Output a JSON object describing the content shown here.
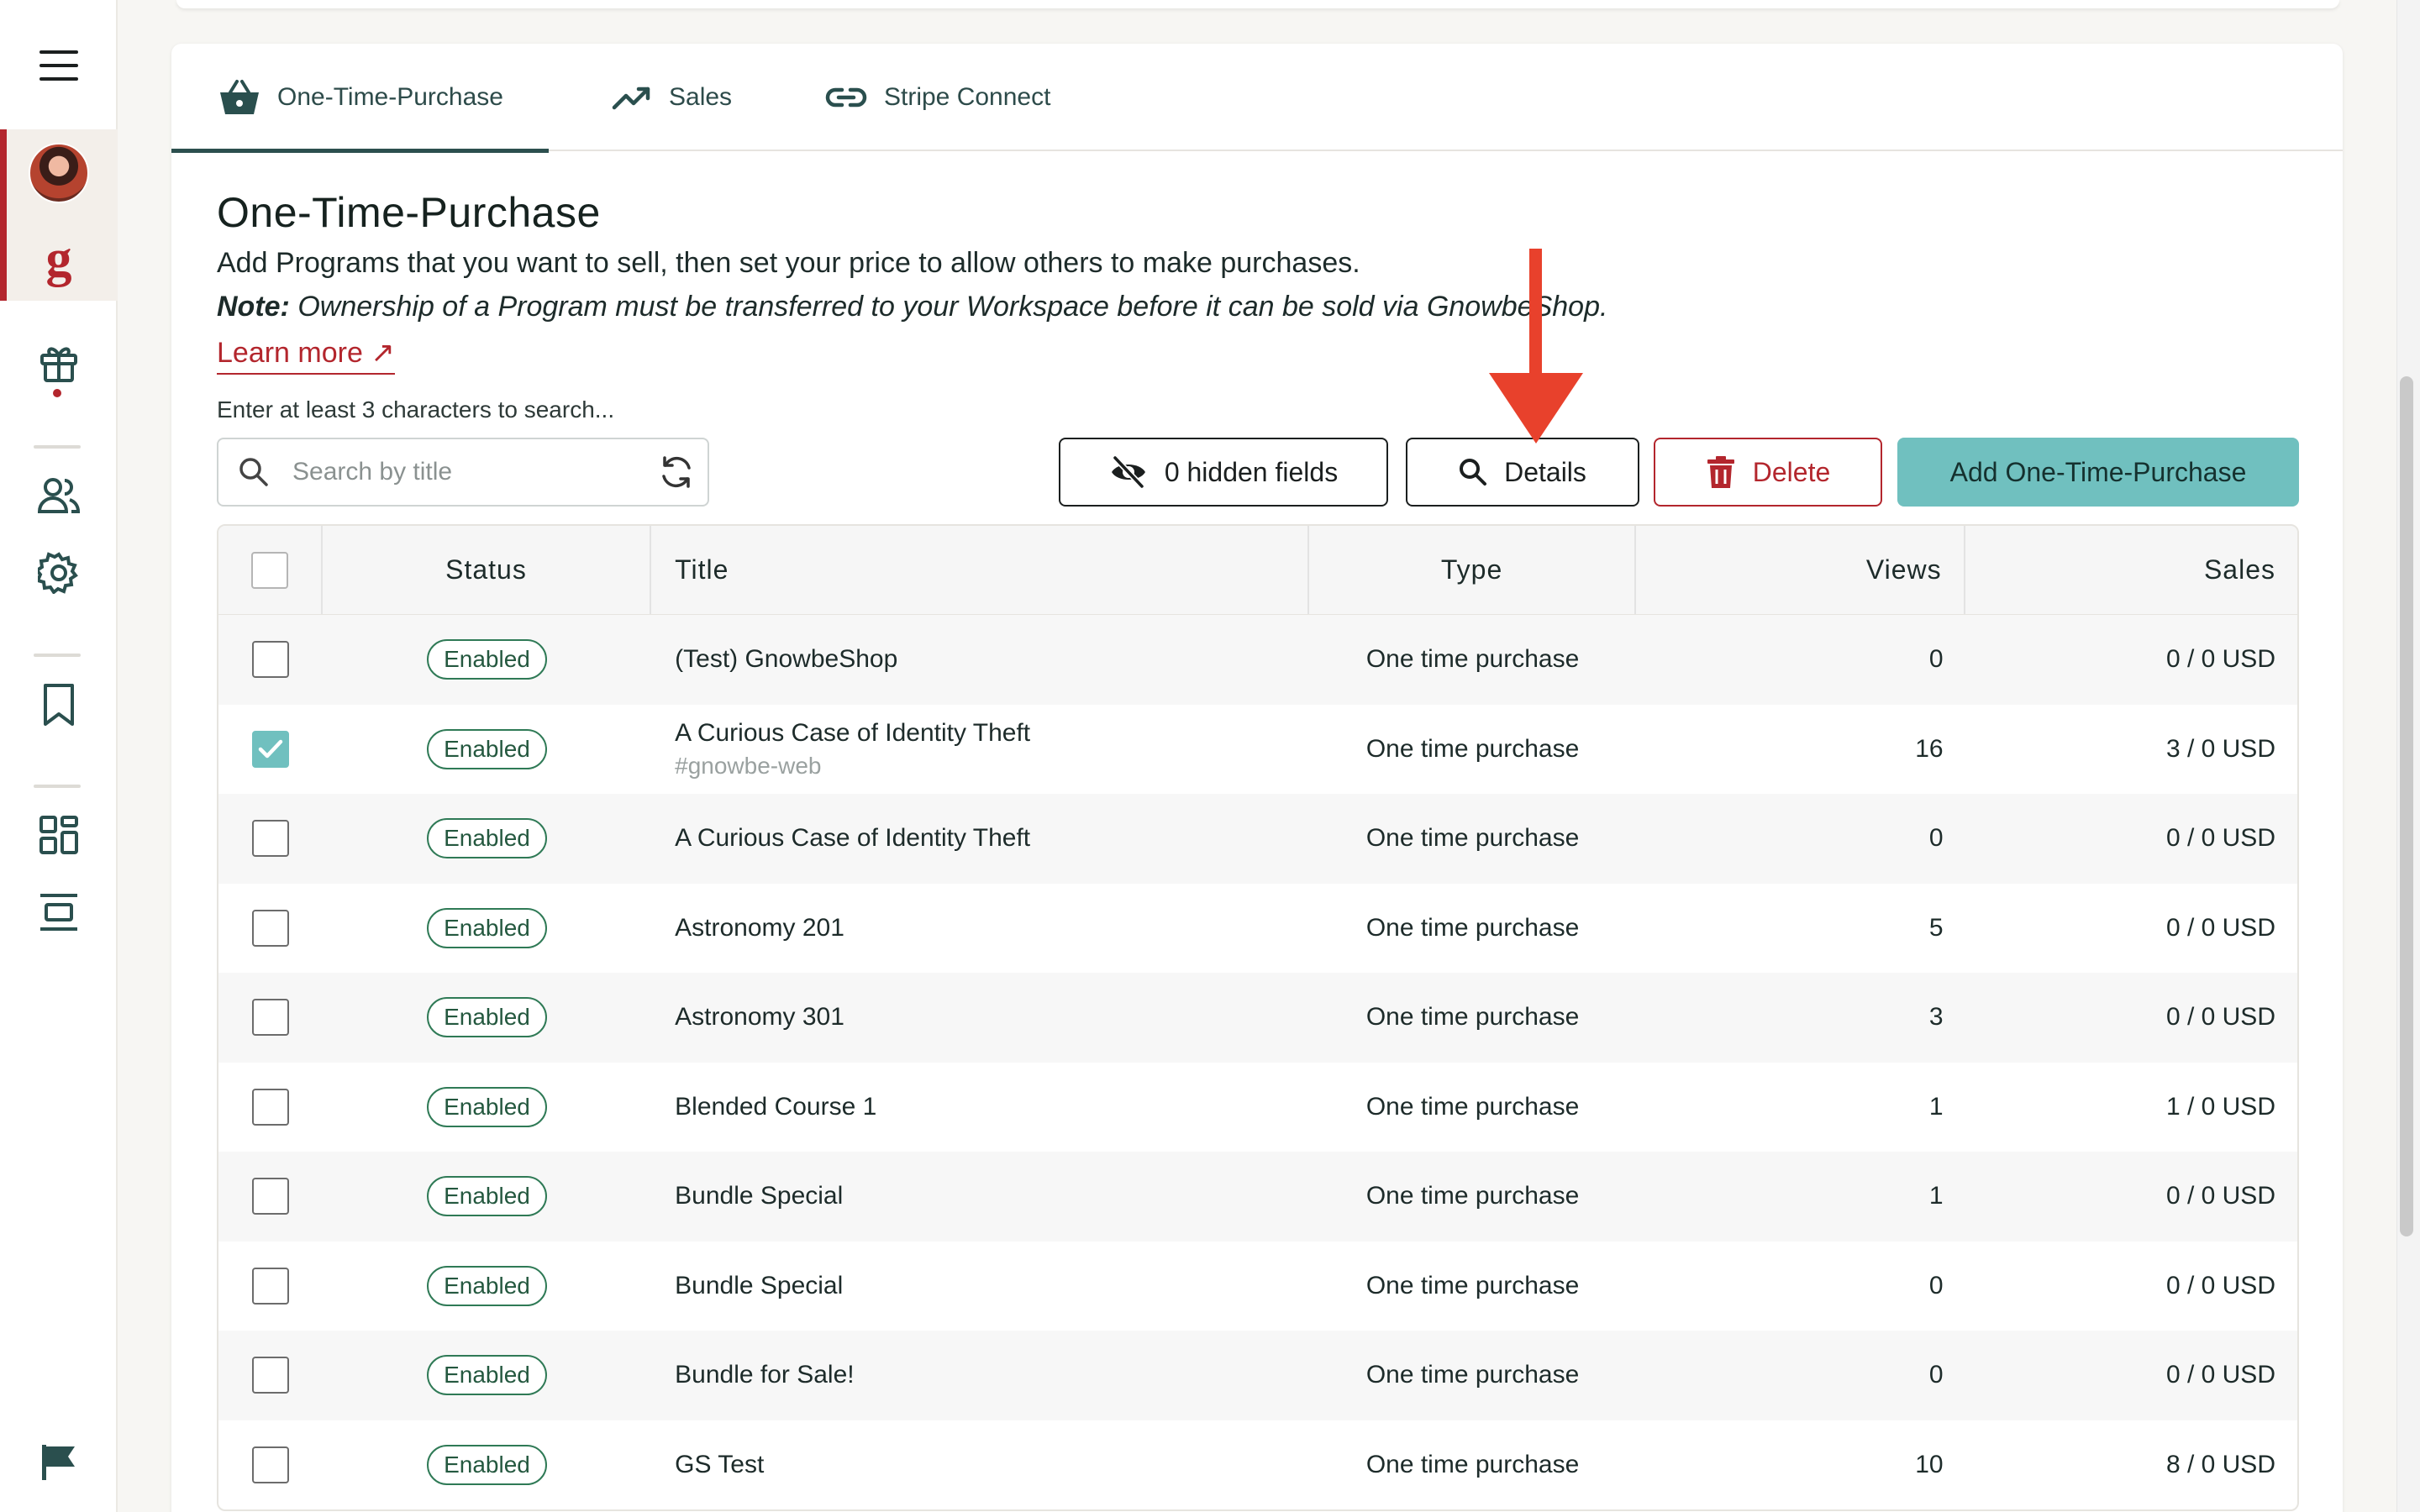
{
  "sidebar": {
    "items": [
      {
        "name": "menu",
        "icon": "hamburger-menu-icon"
      },
      {
        "name": "workspace-avatar",
        "icon": "avatar"
      },
      {
        "name": "workspace-logo",
        "icon": "g-logo",
        "text": "g"
      },
      {
        "name": "gift",
        "icon": "gift-icon"
      },
      {
        "name": "users",
        "icon": "users-icon"
      },
      {
        "name": "settings",
        "icon": "gear-icon"
      },
      {
        "name": "bookmarks",
        "icon": "bookmark-icon"
      },
      {
        "name": "dashboard",
        "icon": "dashboard-icon"
      },
      {
        "name": "layout",
        "icon": "layout-icon"
      },
      {
        "name": "flag",
        "icon": "flag-icon"
      }
    ]
  },
  "tabs": [
    {
      "label": "One-Time-Purchase",
      "icon": "basket-icon",
      "active": true
    },
    {
      "label": "Sales",
      "icon": "trending-up-icon",
      "active": false
    },
    {
      "label": "Stripe Connect",
      "icon": "link-icon",
      "active": false
    }
  ],
  "page": {
    "title": "One-Time-Purchase",
    "description": "Add Programs that you want to sell, then set your price to allow others to make purchases.",
    "note_label": "Note:",
    "note_text": " Ownership of a Program must be transferred to your Workspace before it can be sold via GnowbeShop.",
    "learn_more": "Learn more ↗",
    "search_hint": "Enter at least 3 characters to search..."
  },
  "search": {
    "placeholder": "Search by title",
    "value": ""
  },
  "toolbar": {
    "hidden_fields_label": "0 hidden fields",
    "details_label": "Details",
    "delete_label": "Delete",
    "add_label": "Add One-Time-Purchase"
  },
  "table": {
    "headers": {
      "status": "Status",
      "title": "Title",
      "type": "Type",
      "views": "Views",
      "sales": "Sales"
    },
    "rows": [
      {
        "checked": false,
        "status": "Enabled",
        "title": "(Test) GnowbeShop",
        "tag": "",
        "type": "One time purchase",
        "views": "0",
        "sales": "0 / 0 USD"
      },
      {
        "checked": true,
        "status": "Enabled",
        "title": "A Curious Case of Identity Theft",
        "tag": "#gnowbe-web",
        "type": "One time purchase",
        "views": "16",
        "sales": "3 / 0 USD"
      },
      {
        "checked": false,
        "status": "Enabled",
        "title": "A Curious Case of Identity Theft",
        "tag": "",
        "type": "One time purchase",
        "views": "0",
        "sales": "0 / 0 USD"
      },
      {
        "checked": false,
        "status": "Enabled",
        "title": "Astronomy 201",
        "tag": "",
        "type": "One time purchase",
        "views": "5",
        "sales": "0 / 0 USD"
      },
      {
        "checked": false,
        "status": "Enabled",
        "title": "Astronomy 301",
        "tag": "",
        "type": "One time purchase",
        "views": "3",
        "sales": "0 / 0 USD"
      },
      {
        "checked": false,
        "status": "Enabled",
        "title": "Blended Course 1",
        "tag": "",
        "type": "One time purchase",
        "views": "1",
        "sales": "1 / 0 USD"
      },
      {
        "checked": false,
        "status": "Enabled",
        "title": "Bundle Special",
        "tag": "",
        "type": "One time purchase",
        "views": "1",
        "sales": "0 / 0 USD"
      },
      {
        "checked": false,
        "status": "Enabled",
        "title": "Bundle Special",
        "tag": "",
        "type": "One time purchase",
        "views": "0",
        "sales": "0 / 0 USD"
      },
      {
        "checked": false,
        "status": "Enabled",
        "title": "Bundle for Sale!",
        "tag": "",
        "type": "One time purchase",
        "views": "0",
        "sales": "0 / 0 USD"
      },
      {
        "checked": false,
        "status": "Enabled",
        "title": "GS Test",
        "tag": "",
        "type": "One time purchase",
        "views": "10",
        "sales": "8 / 0 USD"
      }
    ]
  },
  "colors": {
    "brand_red": "#b3262d",
    "accent_teal": "#70c0bf",
    "tab_active": "#2c4f4e",
    "badge_green": "#2f7a56",
    "annotation_arrow": "#e8412c"
  }
}
